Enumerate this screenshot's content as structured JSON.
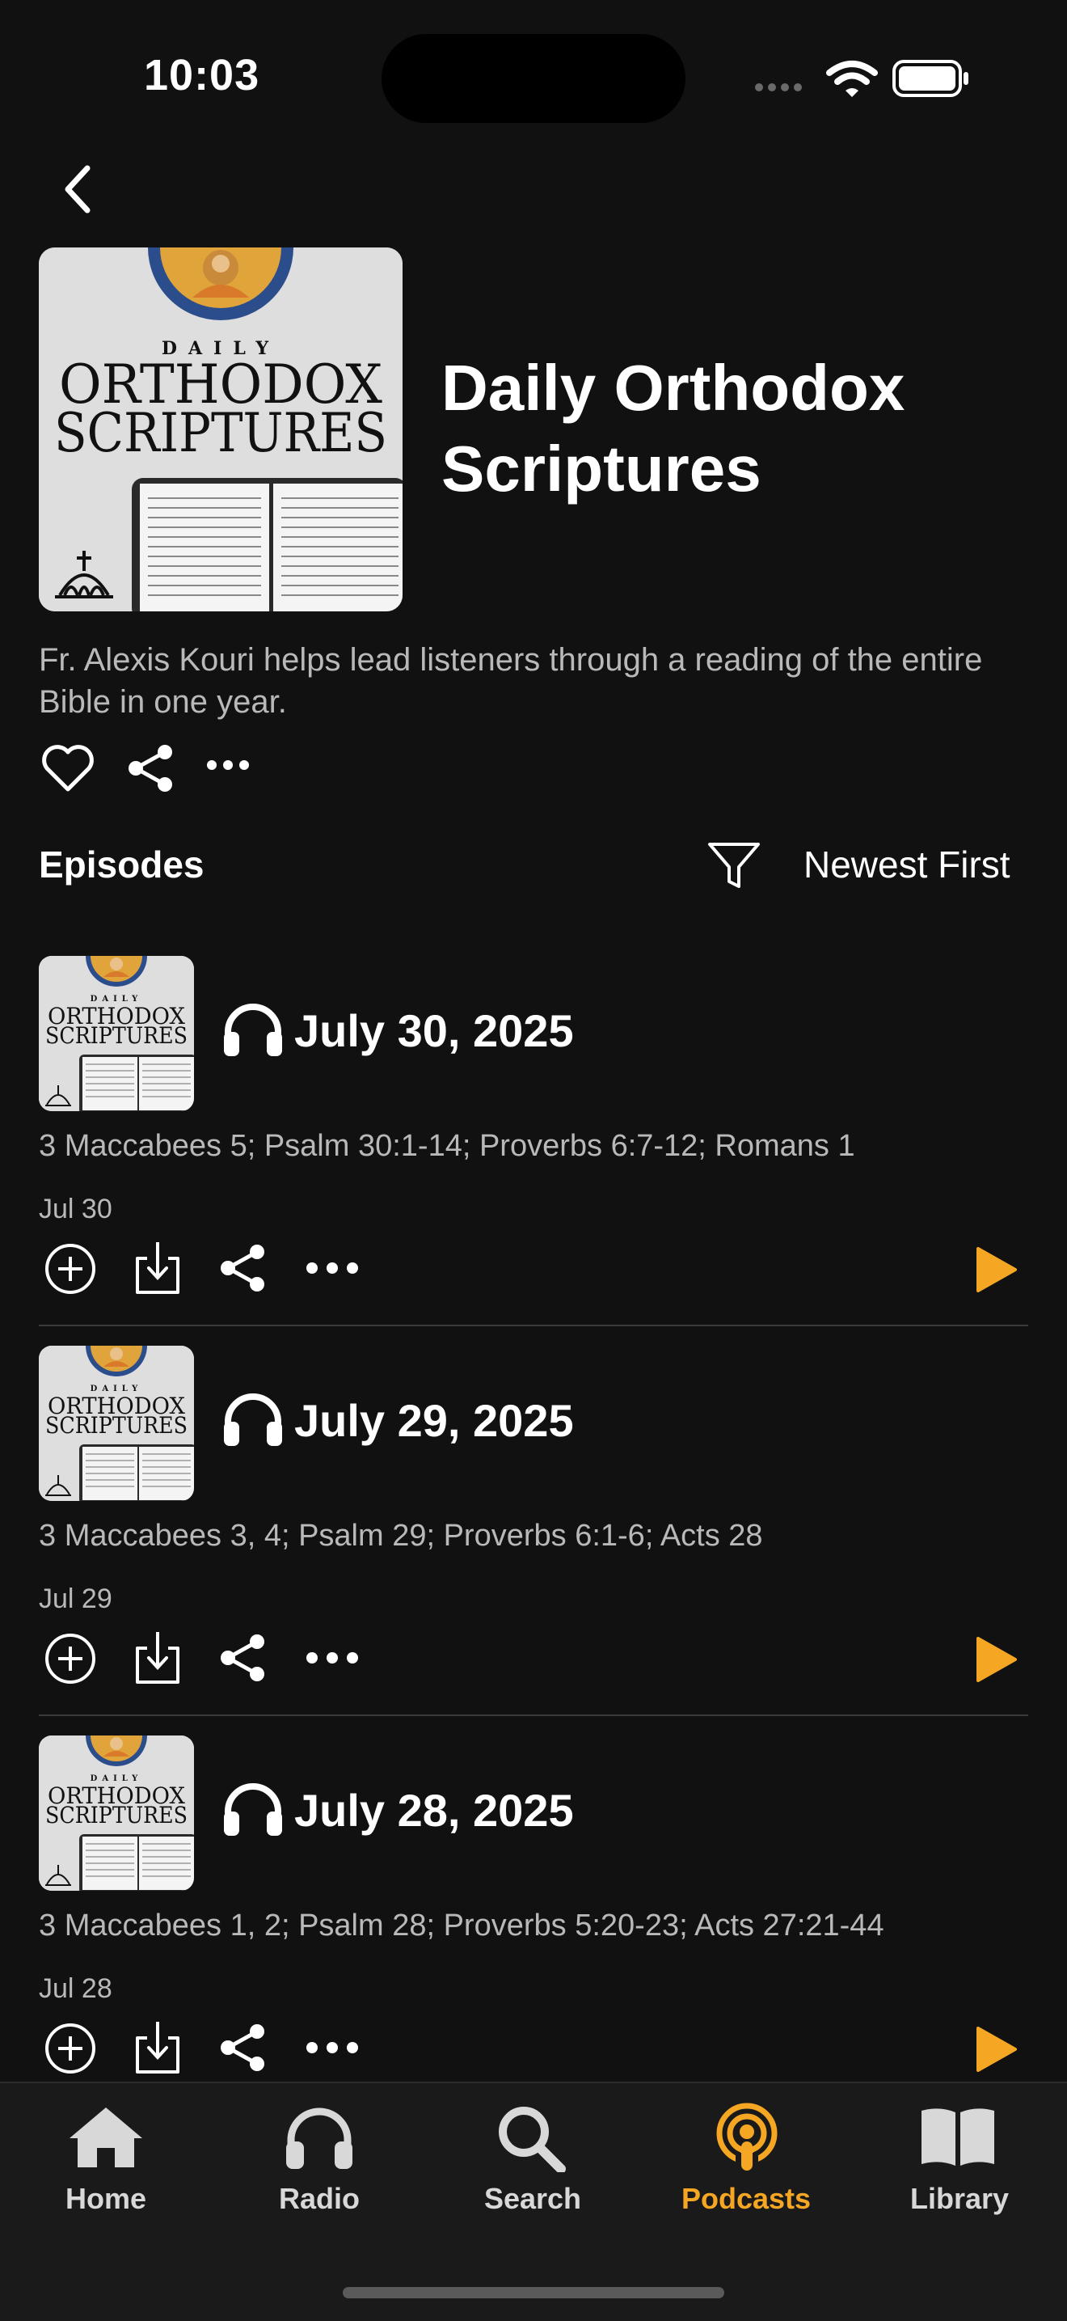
{
  "status_bar": {
    "time": "10:03"
  },
  "podcast": {
    "title_line1": "Daily Orthodox",
    "title_line2": "Scriptures",
    "artwork_text": {
      "top": "DAILY",
      "line1": "ORTHODOX",
      "line2": "SCRIPTURES"
    },
    "description": "Fr. Alexis Kouri helps lead listeners through a reading of the entire Bible in one year."
  },
  "episodes_section": {
    "heading": "Episodes",
    "sort_label": "Newest First"
  },
  "episodes": [
    {
      "title": "July 30, 2025",
      "description": "3 Maccabees 5; Psalm 30:1-14; Proverbs 6:7-12; Romans 1",
      "date": "Jul 30"
    },
    {
      "title": "July 29, 2025",
      "description": "3 Maccabees 3, 4; Psalm 29; Proverbs 6:1-6; Acts 28",
      "date": "Jul 29"
    },
    {
      "title": "July 28, 2025",
      "description": "3 Maccabees 1, 2; Psalm 28; Proverbs 5:20-23; Acts 27:21-44",
      "date": "Jul 28"
    }
  ],
  "tab_bar": {
    "items": [
      {
        "label": "Home",
        "icon": "house-icon"
      },
      {
        "label": "Radio",
        "icon": "headphones-icon"
      },
      {
        "label": "Search",
        "icon": "magnifier-icon"
      },
      {
        "label": "Podcasts",
        "icon": "podcast-icon",
        "active": true
      },
      {
        "label": "Library",
        "icon": "book-icon"
      }
    ],
    "active_color": "#f5a623",
    "inactive_color": "#d8d8d8"
  },
  "colors": {
    "accent": "#f5a623",
    "background": "#111111",
    "secondary_text": "#b9b9b9"
  }
}
